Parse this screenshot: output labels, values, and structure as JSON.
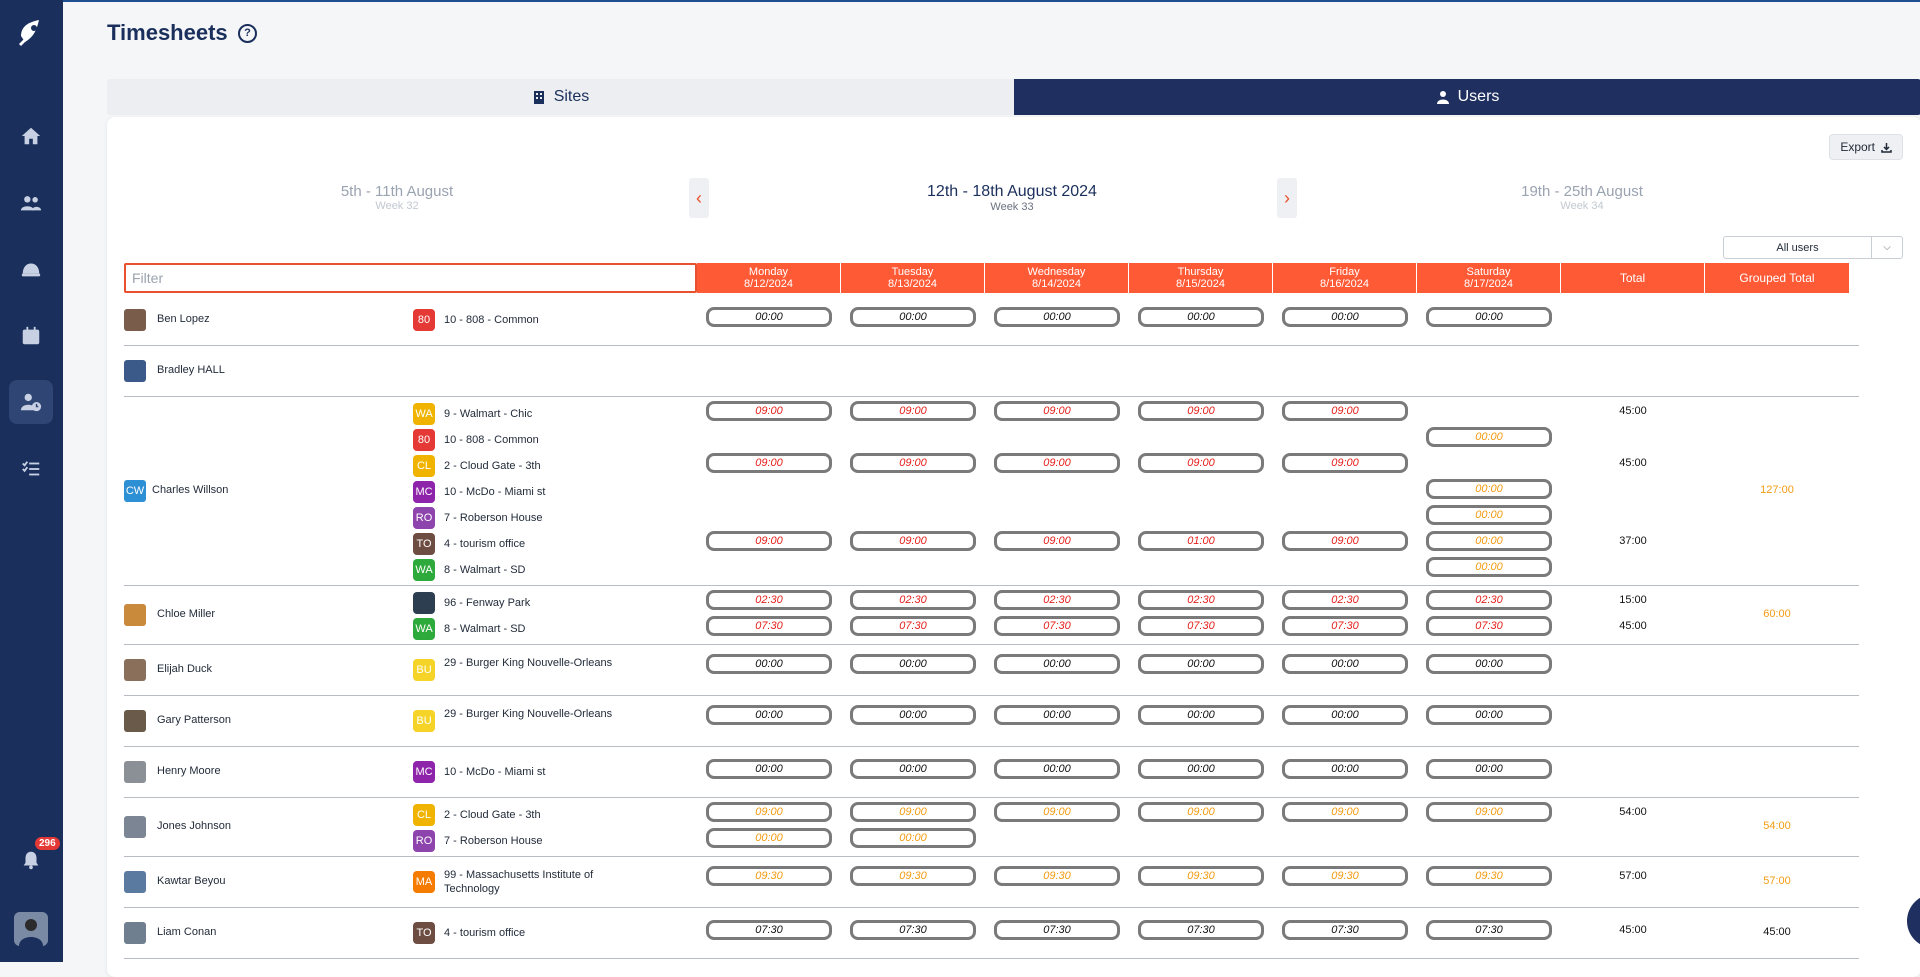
{
  "app": {
    "title": "Timesheets",
    "notification_count": "296",
    "sidebar_items": [
      "home",
      "team",
      "sites",
      "calendar",
      "timesheets",
      "tasks"
    ]
  },
  "tabs": [
    {
      "label": "Sites",
      "icon": "building-icon",
      "active": false
    },
    {
      "label": "Users",
      "icon": "user-icon",
      "active": true
    }
  ],
  "toolbar": {
    "export_label": "Export",
    "filter_placeholder": "Filter",
    "user_select_value": "All users"
  },
  "weeks": {
    "prev": {
      "title": "5th - 11th August",
      "sub": "Week 32"
    },
    "current": {
      "title": "12th - 18th August 2024",
      "sub": "Week 33"
    },
    "next": {
      "title": "19th - 25th August",
      "sub": "Week 34"
    }
  },
  "columns": [
    {
      "day": "Monday",
      "date": "8/12/2024"
    },
    {
      "day": "Tuesday",
      "date": "8/13/2024"
    },
    {
      "day": "Wednesday",
      "date": "8/14/2024"
    },
    {
      "day": "Thursday",
      "date": "8/15/2024"
    },
    {
      "day": "Friday",
      "date": "8/16/2024"
    },
    {
      "day": "Saturday",
      "date": "8/17/2024"
    }
  ],
  "total_headers": {
    "total": "Total",
    "grouped": "Grouped Total"
  },
  "colors": {
    "accent": "#ff5a36",
    "sidebar": "#1a2f5c",
    "red_time": "#e5201b",
    "orange_time": "#f39c12"
  },
  "people": [
    {
      "name": "Ben Lopez",
      "initials": "",
      "avatar_color": "#7a5c4a",
      "grouped": "",
      "grouped_color": "dark",
      "sites": [
        {
          "badge": "80",
          "badge_color": "#e53935",
          "name": "10 - 808 - Common",
          "total": "",
          "cells": [
            [
              "00:00",
              "normal"
            ],
            [
              "00:00",
              "normal"
            ],
            [
              "00:00",
              "normal"
            ],
            [
              "00:00",
              "normal"
            ],
            [
              "00:00",
              "normal"
            ],
            [
              "00:00",
              "normal"
            ]
          ]
        }
      ]
    },
    {
      "name": "Bradley HALL",
      "initials": "",
      "avatar_color": "#3b5a8a",
      "grouped": "",
      "grouped_color": "dark",
      "sites": []
    },
    {
      "name": "Charles Willson",
      "initials": "CW",
      "avatar_color": "#2d8fd4",
      "grouped": "127:00",
      "grouped_color": "orange",
      "sites": [
        {
          "badge": "WA",
          "badge_color": "#f0b400",
          "name": "9 - Walmart - Chic",
          "total": "45:00",
          "cells": [
            [
              "09:00",
              "red"
            ],
            [
              "09:00",
              "red"
            ],
            [
              "09:00",
              "red"
            ],
            [
              "09:00",
              "red"
            ],
            [
              "09:00",
              "red"
            ],
            null
          ]
        },
        {
          "badge": "80",
          "badge_color": "#e53935",
          "name": "10 - 808 - Common",
          "total": "",
          "cells": [
            null,
            null,
            null,
            null,
            null,
            [
              "00:00",
              "orange"
            ]
          ]
        },
        {
          "badge": "CL",
          "badge_color": "#f0b400",
          "name": "2 - Cloud Gate - 3th",
          "total": "45:00",
          "cells": [
            [
              "09:00",
              "red"
            ],
            [
              "09:00",
              "red"
            ],
            [
              "09:00",
              "red"
            ],
            [
              "09:00",
              "red"
            ],
            [
              "09:00",
              "red"
            ],
            null
          ]
        },
        {
          "badge": "MC",
          "badge_color": "#8e24aa",
          "name": "10 - McDo - Miami st",
          "total": "",
          "cells": [
            null,
            null,
            null,
            null,
            null,
            [
              "00:00",
              "orange"
            ]
          ]
        },
        {
          "badge": "RO",
          "badge_color": "#8e44ad",
          "name": "7 - Roberson House",
          "total": "",
          "cells": [
            null,
            null,
            null,
            null,
            null,
            [
              "00:00",
              "orange"
            ]
          ]
        },
        {
          "badge": "TO",
          "badge_color": "#6d4c41",
          "name": "4 - tourism office",
          "total": "37:00",
          "cells": [
            [
              "09:00",
              "red"
            ],
            [
              "09:00",
              "red"
            ],
            [
              "09:00",
              "red"
            ],
            [
              "01:00",
              "red"
            ],
            [
              "09:00",
              "red"
            ],
            [
              "00:00",
              "orange"
            ]
          ]
        },
        {
          "badge": "WA",
          "badge_color": "#2eaa3c",
          "name": "8 - Walmart - SD",
          "total": "",
          "cells": [
            null,
            null,
            null,
            null,
            null,
            [
              "00:00",
              "orange"
            ]
          ]
        }
      ]
    },
    {
      "name": "Chloe Miller",
      "initials": "",
      "avatar_color": "#c98a3c",
      "grouped": "60:00",
      "grouped_color": "orange",
      "sites": [
        {
          "badge": "",
          "badge_color": "#2c3e50",
          "name": "96 - Fenway Park",
          "total": "15:00",
          "cells": [
            [
              "02:30",
              "red"
            ],
            [
              "02:30",
              "red"
            ],
            [
              "02:30",
              "red"
            ],
            [
              "02:30",
              "red"
            ],
            [
              "02:30",
              "red"
            ],
            [
              "02:30",
              "red"
            ]
          ]
        },
        {
          "badge": "WA",
          "badge_color": "#2eaa3c",
          "name": "8 - Walmart - SD",
          "total": "45:00",
          "cells": [
            [
              "07:30",
              "red"
            ],
            [
              "07:30",
              "red"
            ],
            [
              "07:30",
              "red"
            ],
            [
              "07:30",
              "red"
            ],
            [
              "07:30",
              "red"
            ],
            [
              "07:30",
              "red"
            ]
          ]
        }
      ]
    },
    {
      "name": "Elijah Duck",
      "initials": "",
      "avatar_color": "#8a6f5a",
      "grouped": "",
      "grouped_color": "dark",
      "sites": [
        {
          "badge": "BU",
          "badge_color": "#f5d327",
          "name": "29 - Burger King Nouvelle-Orleans",
          "total": "",
          "cells": [
            [
              "00:00",
              "normal"
            ],
            [
              "00:00",
              "normal"
            ],
            [
              "00:00",
              "normal"
            ],
            [
              "00:00",
              "normal"
            ],
            [
              "00:00",
              "normal"
            ],
            [
              "00:00",
              "normal"
            ]
          ]
        }
      ]
    },
    {
      "name": "Gary Patterson",
      "initials": "",
      "avatar_color": "#6a5a4a",
      "grouped": "",
      "grouped_color": "dark",
      "sites": [
        {
          "badge": "BU",
          "badge_color": "#f5d327",
          "name": "29 - Burger King Nouvelle-Orleans",
          "total": "",
          "cells": [
            [
              "00:00",
              "normal"
            ],
            [
              "00:00",
              "normal"
            ],
            [
              "00:00",
              "normal"
            ],
            [
              "00:00",
              "normal"
            ],
            [
              "00:00",
              "normal"
            ],
            [
              "00:00",
              "normal"
            ]
          ]
        }
      ]
    },
    {
      "name": "Henry Moore",
      "initials": "",
      "avatar_color": "#8b8f96",
      "grouped": "",
      "grouped_color": "dark",
      "sites": [
        {
          "badge": "MC",
          "badge_color": "#8e24aa",
          "name": "10 - McDo - Miami st",
          "total": "",
          "cells": [
            [
              "00:00",
              "normal"
            ],
            [
              "00:00",
              "normal"
            ],
            [
              "00:00",
              "normal"
            ],
            [
              "00:00",
              "normal"
            ],
            [
              "00:00",
              "normal"
            ],
            [
              "00:00",
              "normal"
            ]
          ]
        }
      ]
    },
    {
      "name": "Jones Johnson",
      "initials": "",
      "avatar_color": "#7c8593",
      "grouped": "54:00",
      "grouped_color": "orange",
      "sites": [
        {
          "badge": "CL",
          "badge_color": "#f0b400",
          "name": "2 - Cloud Gate - 3th",
          "total": "54:00",
          "cells": [
            [
              "09:00",
              "orange"
            ],
            [
              "09:00",
              "orange"
            ],
            [
              "09:00",
              "orange"
            ],
            [
              "09:00",
              "orange"
            ],
            [
              "09:00",
              "orange"
            ],
            [
              "09:00",
              "orange"
            ]
          ]
        },
        {
          "badge": "RO",
          "badge_color": "#8e44ad",
          "name": "7 - Roberson House",
          "total": "",
          "cells": [
            [
              "00:00",
              "orange"
            ],
            [
              "00:00",
              "orange"
            ],
            null,
            null,
            null,
            null
          ]
        }
      ]
    },
    {
      "name": "Kawtar Beyou",
      "initials": "",
      "avatar_color": "#5b7aa0",
      "grouped": "57:00",
      "grouped_color": "orange",
      "sites": [
        {
          "badge": "MA",
          "badge_color": "#f57c00",
          "name": "99 - Massachusetts Institute of Technology",
          "total": "57:00",
          "cells": [
            [
              "09:30",
              "orange"
            ],
            [
              "09:30",
              "orange"
            ],
            [
              "09:30",
              "orange"
            ],
            [
              "09:30",
              "orange"
            ],
            [
              "09:30",
              "orange"
            ],
            [
              "09:30",
              "orange"
            ]
          ]
        }
      ]
    },
    {
      "name": "Liam Conan",
      "initials": "",
      "avatar_color": "#6f7f8f",
      "grouped": "45:00",
      "grouped_color": "dark",
      "sites": [
        {
          "badge": "TO",
          "badge_color": "#6d4c41",
          "name": "4 - tourism office",
          "total": "45:00",
          "cells": [
            [
              "07:30",
              "normal"
            ],
            [
              "07:30",
              "normal"
            ],
            [
              "07:30",
              "normal"
            ],
            [
              "07:30",
              "normal"
            ],
            [
              "07:30",
              "normal"
            ],
            [
              "07:30",
              "normal"
            ]
          ]
        }
      ]
    }
  ]
}
